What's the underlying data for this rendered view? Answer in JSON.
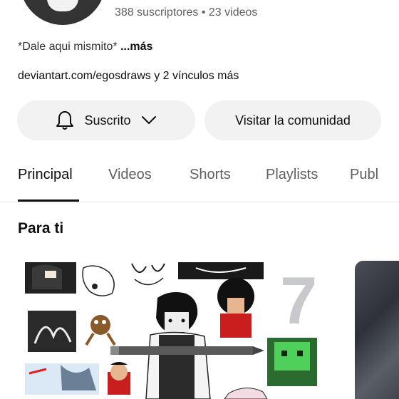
{
  "channel": {
    "subscriber_count": "388 suscriptores",
    "separator": "•",
    "video_count": "23 videos",
    "description": "*Dale aqui mismito*",
    "description_more": "...más",
    "links": "deviantart.com/egosdraws y 2 vínculos más"
  },
  "actions": {
    "subscribed_label": "Suscrito",
    "community_label": "Visitar la comunidad"
  },
  "tabs": [
    {
      "label": "Principal"
    },
    {
      "label": "Videos"
    },
    {
      "label": "Shorts"
    },
    {
      "label": "Playlists"
    },
    {
      "label": "Publ"
    }
  ],
  "section": {
    "title": "Para ti"
  },
  "thumbnail": {
    "number": "7"
  },
  "icons": [
    "bell-icon",
    "chevron-down-icon"
  ]
}
